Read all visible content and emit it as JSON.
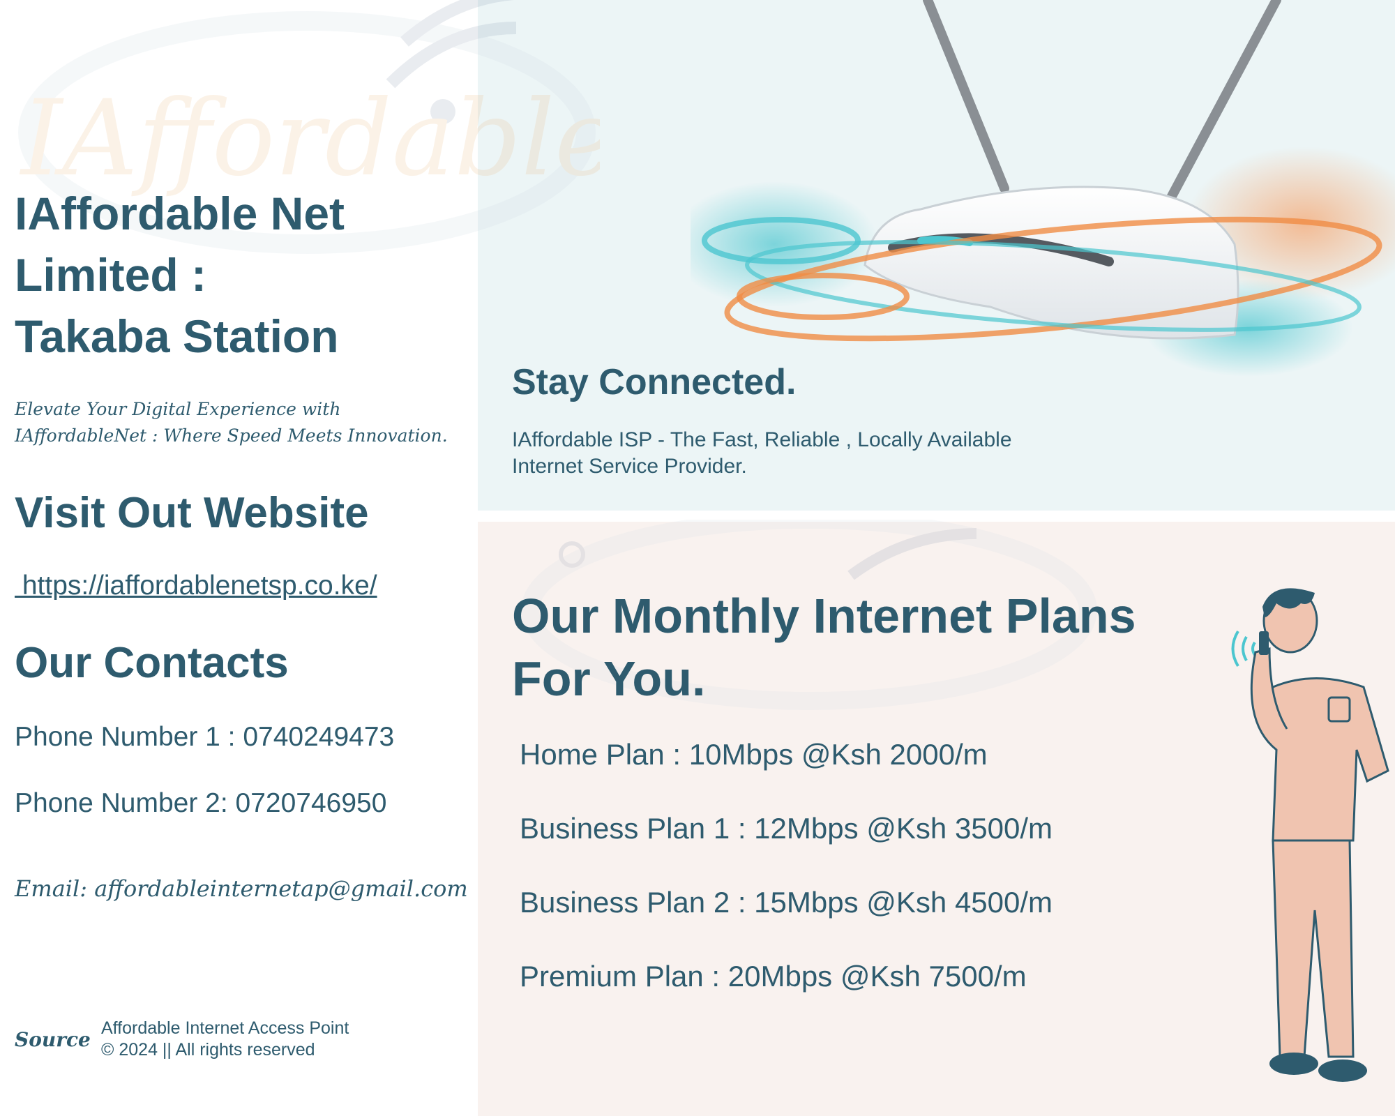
{
  "company": {
    "title_line1": "IAffordable Net",
    "title_line2": "Limited :",
    "title_line3": "Takaba Station",
    "tagline_line1": "Elevate Your Digital Experience with",
    "tagline_line2": "IAffordableNet : Where Speed Meets Innovation."
  },
  "website": {
    "heading": "Visit Out Website",
    "url": " https://iaffordablenetsp.co.ke/"
  },
  "contacts": {
    "heading": "Our Contacts",
    "phone1": "Phone Number 1 : 0740249473",
    "phone2": "Phone Number 2: 0720746950",
    "email": "Email: affordableinternetap@gmail.com"
  },
  "footer": {
    "source_label": "Source",
    "line1": "Affordable Internet Access Point",
    "line2": "© 2024 || All rights reserved"
  },
  "watermark": {
    "text": "IAffordable AP"
  },
  "hero": {
    "title": "Stay Connected.",
    "description_line1": "IAffordable ISP - The Fast, Reliable , Locally Available",
    "description_line2": "Internet Service Provider."
  },
  "plans": {
    "title_line1": "Our Monthly Internet Plans",
    "title_line2": "For You.",
    "items": [
      "Home Plan : 10Mbps @Ksh 2000/m",
      "Business Plan 1 : 12Mbps @Ksh 3500/m",
      "Business Plan 2 : 15Mbps @Ksh 4500/m",
      "Premium Plan : 20Mbps @Ksh 7500/m"
    ]
  },
  "colors": {
    "text": "#2e5b6e",
    "top_panel_bg": "#ecf5f6",
    "bottom_panel_bg": "#f9f2ef",
    "accent_orange": "#f08c45",
    "accent_teal": "#4cc6cf",
    "person_skin": "#f0c4b0"
  },
  "icons": [
    "router-illustration",
    "person-on-phone-illustration",
    "wifi-logo-watermark"
  ]
}
